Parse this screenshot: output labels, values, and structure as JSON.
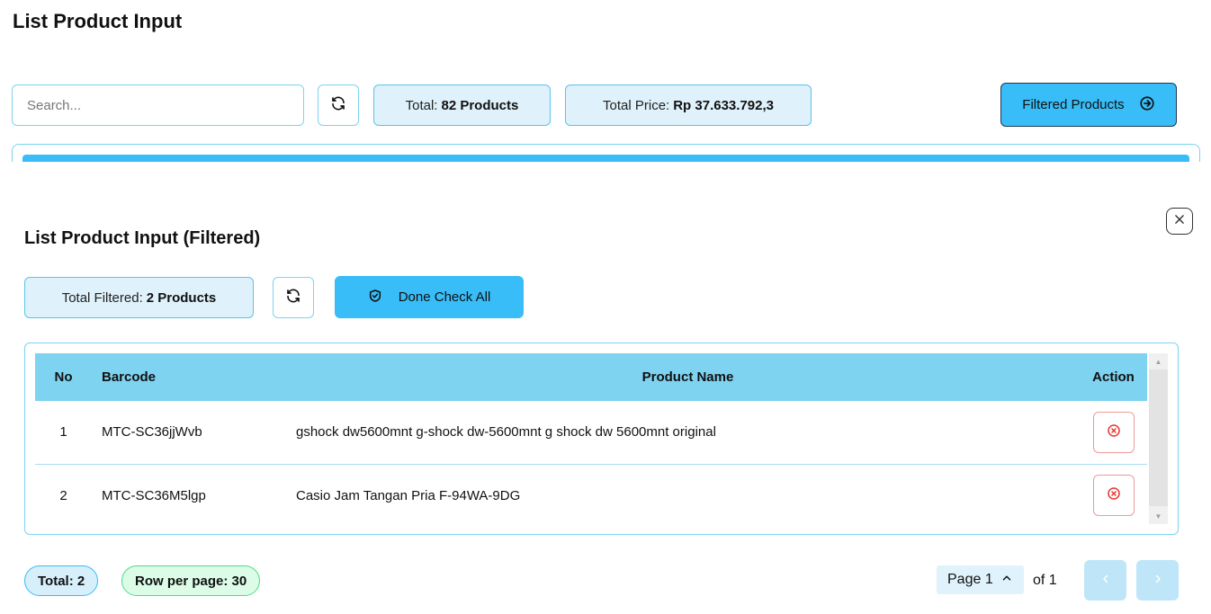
{
  "page": {
    "title": "List Product Input"
  },
  "toolbar": {
    "search_placeholder": "Search...",
    "total_label": "Total:",
    "total_value": "82 Products",
    "total_price_label": "Total Price:",
    "total_price_value": "Rp 37.633.792,3",
    "filtered_button_label": "Filtered Products"
  },
  "modal": {
    "title": "List Product Input (Filtered)",
    "total_filtered_label": "Total Filtered:",
    "total_filtered_value": "2 Products",
    "done_check_all_label": "Done Check All",
    "table": {
      "headers": {
        "no": "No",
        "barcode": "Barcode",
        "product_name": "Product Name",
        "action": "Action"
      },
      "rows": [
        {
          "no": "1",
          "barcode": "MTC-SC36jjWvb",
          "product_name": "gshock dw5600mnt g-shock dw-5600mnt g shock dw 5600mnt original"
        },
        {
          "no": "2",
          "barcode": "MTC-SC36M5lgp",
          "product_name": "Casio Jam Tangan Pria F-94WA-9DG"
        }
      ]
    },
    "footer": {
      "total_pill": "Total: 2",
      "rows_per_page_pill": "Row per page: 30",
      "page_label": "Page 1",
      "of_label": "of 1"
    }
  },
  "colors": {
    "accent": "#38bdf8",
    "accent_light": "#7dd3f0",
    "danger": "#e53935",
    "success_border": "#4ade80"
  }
}
